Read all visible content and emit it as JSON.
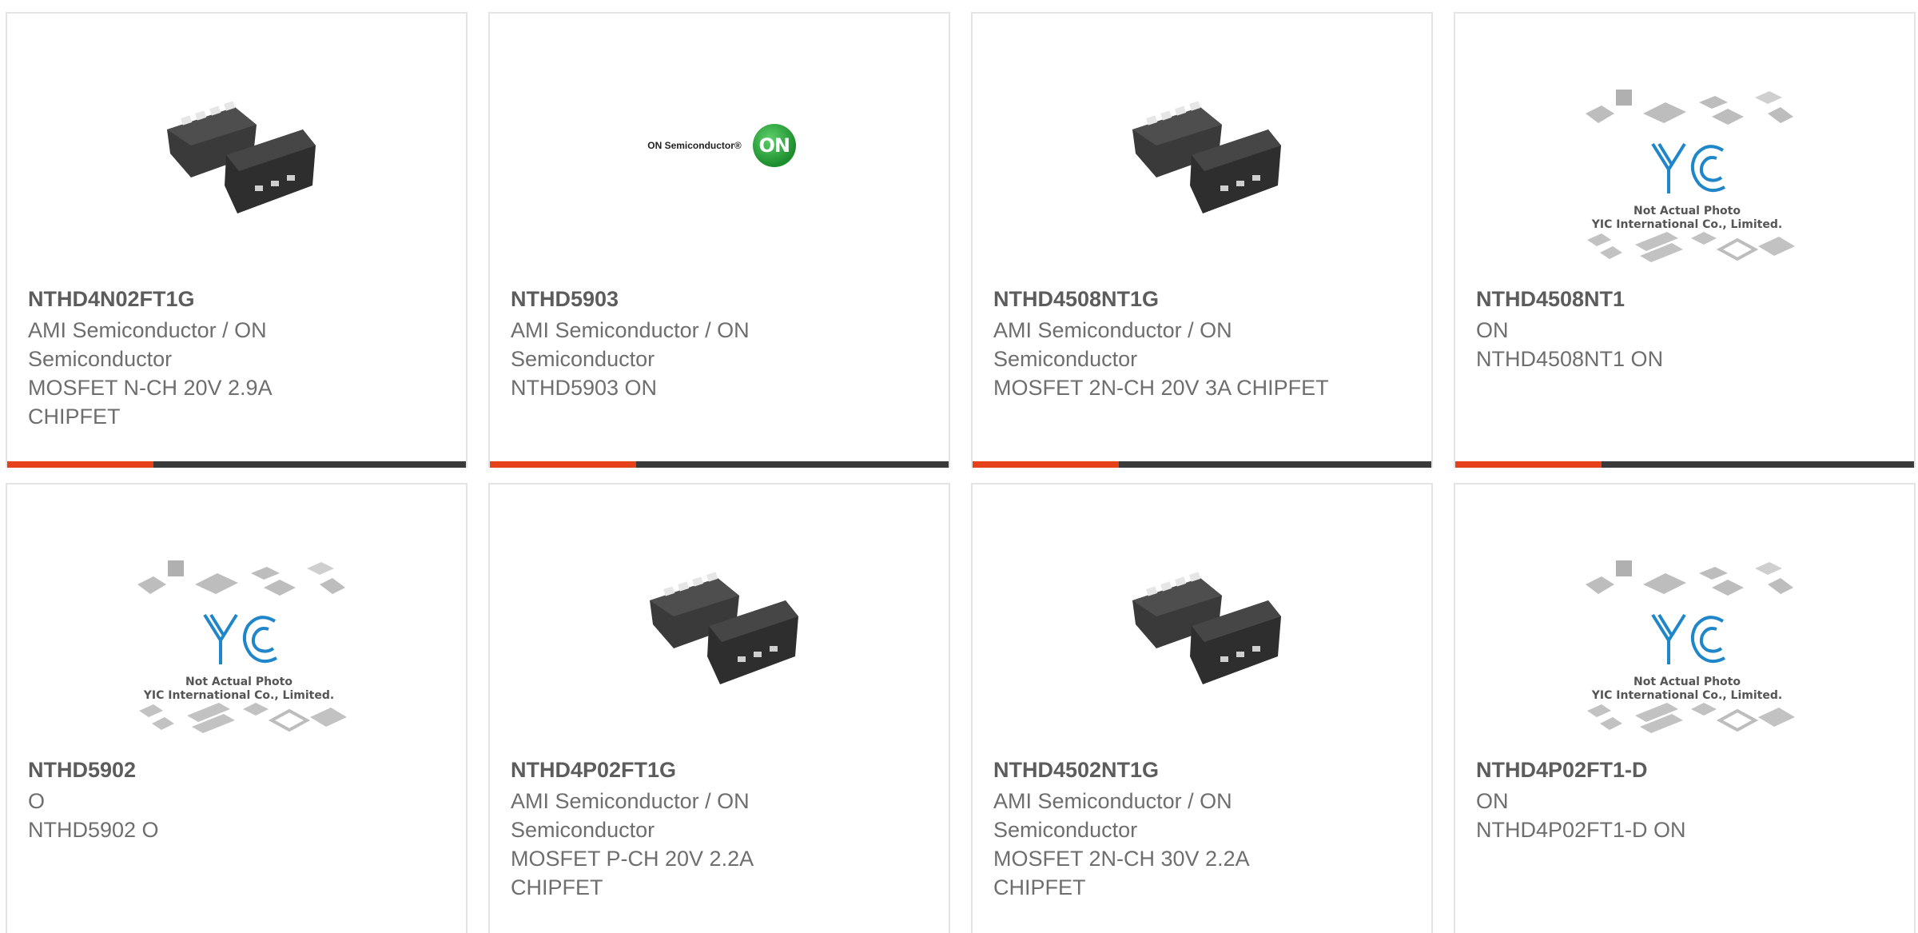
{
  "products": [
    {
      "title": "NTHD4N02FT1G",
      "lines": [
        "AMI Semiconductor / ON Semiconductor",
        "MOSFET N-CH 20V 2.9A CHIPFET"
      ],
      "image": "chipfet-package"
    },
    {
      "title": "NTHD5903",
      "lines": [
        "AMI Semiconductor / ON Semiconductor",
        "NTHD5903 ON"
      ],
      "image": "on-semiconductor-logo"
    },
    {
      "title": "NTHD4508NT1G",
      "lines": [
        "AMI Semiconductor / ON Semiconductor",
        "MOSFET 2N-CH 20V 3A CHIPFET"
      ],
      "image": "chipfet-package"
    },
    {
      "title": "NTHD4508NT1",
      "lines": [
        "ON",
        "NTHD4508NT1 ON"
      ],
      "image": "yic-placeholder"
    },
    {
      "title": "NTHD5902",
      "lines": [
        "O",
        "NTHD5902 O"
      ],
      "image": "yic-placeholder"
    },
    {
      "title": "NTHD4P02FT1G",
      "lines": [
        "AMI Semiconductor / ON Semiconductor",
        "MOSFET P-CH 20V 2.2A CHIPFET"
      ],
      "image": "chipfet-package"
    },
    {
      "title": "NTHD4502NT1G",
      "lines": [
        "AMI Semiconductor / ON Semiconductor",
        "MOSFET 2N-CH 30V 2.2A CHIPFET"
      ],
      "image": "chipfet-package"
    },
    {
      "title": "NTHD4P02FT1-D",
      "lines": [
        "ON",
        "NTHD4P02FT1-D ON"
      ],
      "image": "yic-placeholder"
    }
  ],
  "images": {
    "on_logo_text": "ON Semiconductor®",
    "on_logo_mark": "ON",
    "yic_caption_1": "Not Actual Photo",
    "yic_caption_2": "YIC International Co., Limited."
  },
  "colors": {
    "accent": "#e5421c",
    "bar": "#3a3a3a",
    "border": "#e4e4e4",
    "title": "#5c5c5c",
    "text": "#6e6e6e"
  }
}
